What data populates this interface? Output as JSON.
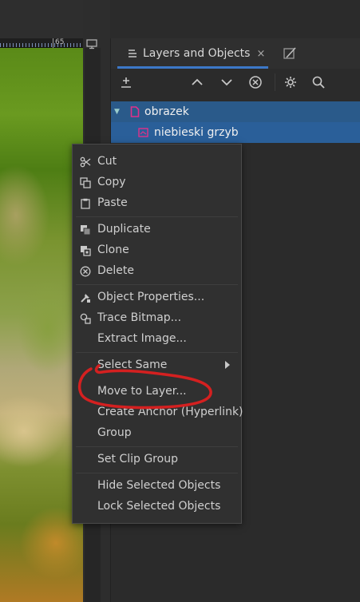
{
  "ruler": {
    "label": "65"
  },
  "panel": {
    "tab_label": "Layers and Objects",
    "tab_close": "×"
  },
  "tree": {
    "parent_label": "obrazek",
    "child_label": "niebieski grzyb"
  },
  "menu": {
    "items": [
      {
        "label": "Cut",
        "icon": "scissors-icon"
      },
      {
        "label": "Copy",
        "icon": "copy-icon"
      },
      {
        "label": "Paste",
        "icon": "paste-icon"
      },
      {
        "label": "Duplicate",
        "icon": "duplicate-icon"
      },
      {
        "label": "Clone",
        "icon": "clone-icon"
      },
      {
        "label": "Delete",
        "icon": "delete-icon"
      },
      {
        "label": "Object Properties...",
        "icon": "object-properties-icon"
      },
      {
        "label": "Trace Bitmap...",
        "icon": "trace-bitmap-icon"
      },
      {
        "label": "Extract Image..."
      },
      {
        "label": "Select Same"
      },
      {
        "label": "Move to Layer..."
      },
      {
        "label": "Create Anchor (Hyperlink)"
      },
      {
        "label": "Group"
      },
      {
        "label": "Set Clip Group"
      },
      {
        "label": "Hide Selected Objects"
      },
      {
        "label": "Lock Selected Objects"
      }
    ]
  },
  "colors": {
    "accent": "#3c78c8",
    "selected_row": "#2a5f99",
    "annotation": "#d42020",
    "layer_icon": "#e0308a"
  }
}
